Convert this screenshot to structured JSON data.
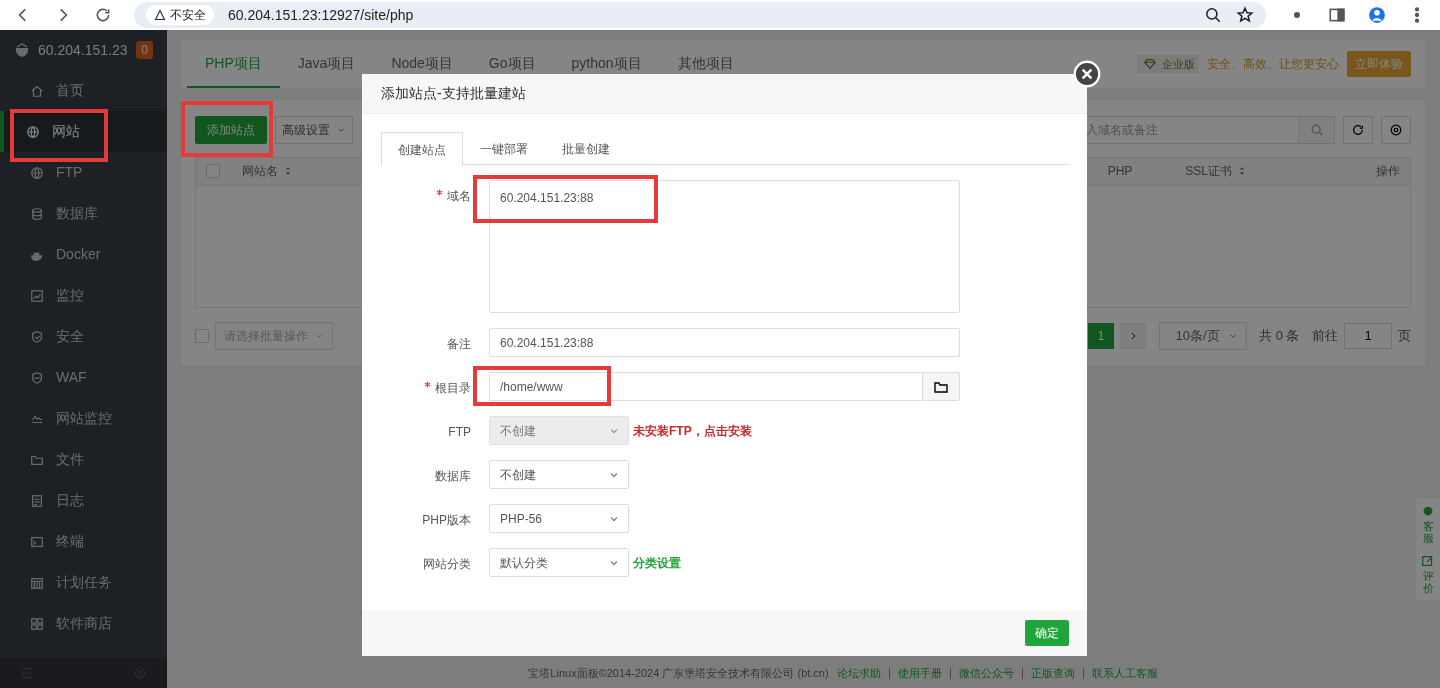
{
  "browser": {
    "security": "不安全",
    "url": "60.204.151.23:12927/site/php"
  },
  "sidebar": {
    "host": "60.204.151.23",
    "badge": "0",
    "items": [
      {
        "label": "首页",
        "selected": false,
        "highlighted": false
      },
      {
        "label": "网站",
        "selected": true,
        "highlighted": true
      },
      {
        "label": "FTP",
        "selected": false,
        "highlighted": false
      },
      {
        "label": "数据库",
        "selected": false,
        "highlighted": false
      },
      {
        "label": "Docker",
        "selected": false,
        "highlighted": false
      },
      {
        "label": "监控",
        "selected": false,
        "highlighted": false
      },
      {
        "label": "安全",
        "selected": false,
        "highlighted": false
      },
      {
        "label": "WAF",
        "selected": false,
        "highlighted": false
      },
      {
        "label": "网站监控",
        "selected": false,
        "highlighted": false
      },
      {
        "label": "文件",
        "selected": false,
        "highlighted": false
      },
      {
        "label": "日志",
        "selected": false,
        "highlighted": false
      },
      {
        "label": "终端",
        "selected": false,
        "highlighted": false
      },
      {
        "label": "计划任务",
        "selected": false,
        "highlighted": false
      },
      {
        "label": "软件商店",
        "selected": false,
        "highlighted": false
      }
    ]
  },
  "project_tabs": [
    {
      "label": "PHP项目",
      "selected": true
    },
    {
      "label": "Java项目",
      "selected": false
    },
    {
      "label": "Node项目",
      "selected": false
    },
    {
      "label": "Go项目",
      "selected": false
    },
    {
      "label": "python项目",
      "selected": false
    },
    {
      "label": "其他项目",
      "selected": false
    }
  ],
  "promo": {
    "edition": "企业版",
    "slogan": "安全、高效、让您更安心",
    "button": "立即体验"
  },
  "toolbar": {
    "add_button": {
      "label": "添加站点",
      "highlighted": true
    },
    "advanced": "高级设置",
    "search_placeholder": "入域名或备注"
  },
  "table": {
    "select_all_checked": false,
    "columns_left": [
      {
        "label": "网站名",
        "sortable": true
      }
    ],
    "columns_right": [
      {
        "label": "PHP",
        "sortable": false
      },
      {
        "label": "SSL证书",
        "sortable": true
      },
      {
        "label": "操作",
        "sortable": false
      }
    ]
  },
  "batch": {
    "checked": false,
    "placeholder": "请选择批量操作"
  },
  "pagination": {
    "pages": [
      {
        "label": "1",
        "selected": true
      }
    ],
    "page_size": "10条/页",
    "total": "共 0 条",
    "goto": "前往",
    "goto_value": "1",
    "page_unit": "页"
  },
  "float_panel": [
    {
      "label": "客服"
    },
    {
      "label": "评价"
    }
  ],
  "footer": {
    "copyright": "宝塔Linux面板©2014-2024 广东堡塔安全技术有限公司 (bt.cn)",
    "links": [
      "论坛求助",
      "使用手册",
      "微信公众号",
      "正版查询",
      "联系人工客服"
    ]
  },
  "modal": {
    "title": "添加站点-支持批量建站",
    "tabs": [
      {
        "label": "创建站点",
        "selected": true
      },
      {
        "label": "一键部署",
        "selected": false
      },
      {
        "label": "批量创建",
        "selected": false
      }
    ],
    "fields": [
      {
        "kind": "textarea",
        "label": "域名",
        "required": true,
        "value": "60.204.151.23:88",
        "highlighted": true
      },
      {
        "kind": "input",
        "label": "备注",
        "required": false,
        "value": "60.204.151.23:88",
        "highlighted": false
      },
      {
        "kind": "path",
        "label": "根目录",
        "required": true,
        "value": "/home/www",
        "highlighted": true
      },
      {
        "kind": "select",
        "label": "FTP",
        "required": false,
        "value": "不创建",
        "disabled": true,
        "highlighted": false,
        "note": {
          "text": "未安装FTP，点击安装",
          "color": "#c82a2a"
        }
      },
      {
        "kind": "select",
        "label": "数据库",
        "required": false,
        "value": "不创建",
        "disabled": false,
        "highlighted": false
      },
      {
        "kind": "select",
        "label": "PHP版本",
        "required": false,
        "value": "PHP-56",
        "disabled": false,
        "highlighted": false
      },
      {
        "kind": "select",
        "label": "网站分类",
        "required": false,
        "value": "默认分类",
        "disabled": false,
        "highlighted": false,
        "note": {
          "text": "分类设置",
          "color": "#20a53a"
        }
      }
    ],
    "confirm": "确定"
  }
}
